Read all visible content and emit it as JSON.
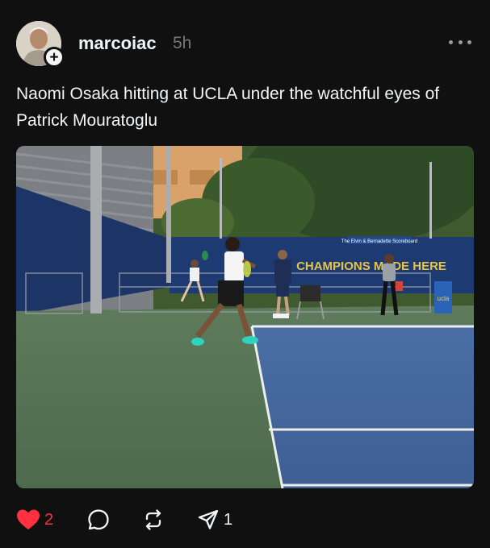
{
  "post": {
    "username": "marcoiac",
    "time": "5h",
    "caption": "Naomi Osaka hitting at UCLA under the watchful eyes of Patrick Mouratoglu",
    "image_text": {
      "banner": "CHAMPIONS MADE HERE",
      "scoreboard": "The Elvin & Bernadette Scoreboard",
      "bin": "ucla"
    }
  },
  "actions": {
    "likes": "2",
    "shares": "1"
  },
  "colors": {
    "background": "#101010",
    "like": "#ff3040",
    "muted": "#777777"
  },
  "icons": [
    "heart-icon",
    "comment-icon",
    "repost-icon",
    "share-icon",
    "more-icon",
    "plus-icon"
  ]
}
